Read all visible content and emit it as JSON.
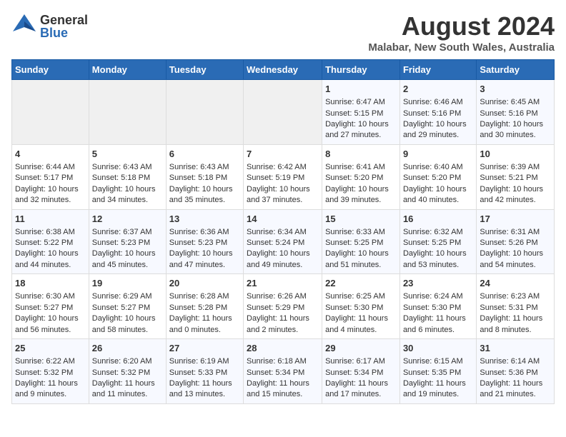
{
  "header": {
    "logo_general": "General",
    "logo_blue": "Blue",
    "month_year": "August 2024",
    "location": "Malabar, New South Wales, Australia"
  },
  "days_of_week": [
    "Sunday",
    "Monday",
    "Tuesday",
    "Wednesday",
    "Thursday",
    "Friday",
    "Saturday"
  ],
  "weeks": [
    [
      {
        "day": "",
        "info": ""
      },
      {
        "day": "",
        "info": ""
      },
      {
        "day": "",
        "info": ""
      },
      {
        "day": "",
        "info": ""
      },
      {
        "day": "1",
        "info": "Sunrise: 6:47 AM\nSunset: 5:15 PM\nDaylight: 10 hours and 27 minutes."
      },
      {
        "day": "2",
        "info": "Sunrise: 6:46 AM\nSunset: 5:16 PM\nDaylight: 10 hours and 29 minutes."
      },
      {
        "day": "3",
        "info": "Sunrise: 6:45 AM\nSunset: 5:16 PM\nDaylight: 10 hours and 30 minutes."
      }
    ],
    [
      {
        "day": "4",
        "info": "Sunrise: 6:44 AM\nSunset: 5:17 PM\nDaylight: 10 hours and 32 minutes."
      },
      {
        "day": "5",
        "info": "Sunrise: 6:43 AM\nSunset: 5:18 PM\nDaylight: 10 hours and 34 minutes."
      },
      {
        "day": "6",
        "info": "Sunrise: 6:43 AM\nSunset: 5:18 PM\nDaylight: 10 hours and 35 minutes."
      },
      {
        "day": "7",
        "info": "Sunrise: 6:42 AM\nSunset: 5:19 PM\nDaylight: 10 hours and 37 minutes."
      },
      {
        "day": "8",
        "info": "Sunrise: 6:41 AM\nSunset: 5:20 PM\nDaylight: 10 hours and 39 minutes."
      },
      {
        "day": "9",
        "info": "Sunrise: 6:40 AM\nSunset: 5:20 PM\nDaylight: 10 hours and 40 minutes."
      },
      {
        "day": "10",
        "info": "Sunrise: 6:39 AM\nSunset: 5:21 PM\nDaylight: 10 hours and 42 minutes."
      }
    ],
    [
      {
        "day": "11",
        "info": "Sunrise: 6:38 AM\nSunset: 5:22 PM\nDaylight: 10 hours and 44 minutes."
      },
      {
        "day": "12",
        "info": "Sunrise: 6:37 AM\nSunset: 5:23 PM\nDaylight: 10 hours and 45 minutes."
      },
      {
        "day": "13",
        "info": "Sunrise: 6:36 AM\nSunset: 5:23 PM\nDaylight: 10 hours and 47 minutes."
      },
      {
        "day": "14",
        "info": "Sunrise: 6:34 AM\nSunset: 5:24 PM\nDaylight: 10 hours and 49 minutes."
      },
      {
        "day": "15",
        "info": "Sunrise: 6:33 AM\nSunset: 5:25 PM\nDaylight: 10 hours and 51 minutes."
      },
      {
        "day": "16",
        "info": "Sunrise: 6:32 AM\nSunset: 5:25 PM\nDaylight: 10 hours and 53 minutes."
      },
      {
        "day": "17",
        "info": "Sunrise: 6:31 AM\nSunset: 5:26 PM\nDaylight: 10 hours and 54 minutes."
      }
    ],
    [
      {
        "day": "18",
        "info": "Sunrise: 6:30 AM\nSunset: 5:27 PM\nDaylight: 10 hours and 56 minutes."
      },
      {
        "day": "19",
        "info": "Sunrise: 6:29 AM\nSunset: 5:27 PM\nDaylight: 10 hours and 58 minutes."
      },
      {
        "day": "20",
        "info": "Sunrise: 6:28 AM\nSunset: 5:28 PM\nDaylight: 11 hours and 0 minutes."
      },
      {
        "day": "21",
        "info": "Sunrise: 6:26 AM\nSunset: 5:29 PM\nDaylight: 11 hours and 2 minutes."
      },
      {
        "day": "22",
        "info": "Sunrise: 6:25 AM\nSunset: 5:30 PM\nDaylight: 11 hours and 4 minutes."
      },
      {
        "day": "23",
        "info": "Sunrise: 6:24 AM\nSunset: 5:30 PM\nDaylight: 11 hours and 6 minutes."
      },
      {
        "day": "24",
        "info": "Sunrise: 6:23 AM\nSunset: 5:31 PM\nDaylight: 11 hours and 8 minutes."
      }
    ],
    [
      {
        "day": "25",
        "info": "Sunrise: 6:22 AM\nSunset: 5:32 PM\nDaylight: 11 hours and 9 minutes."
      },
      {
        "day": "26",
        "info": "Sunrise: 6:20 AM\nSunset: 5:32 PM\nDaylight: 11 hours and 11 minutes."
      },
      {
        "day": "27",
        "info": "Sunrise: 6:19 AM\nSunset: 5:33 PM\nDaylight: 11 hours and 13 minutes."
      },
      {
        "day": "28",
        "info": "Sunrise: 6:18 AM\nSunset: 5:34 PM\nDaylight: 11 hours and 15 minutes."
      },
      {
        "day": "29",
        "info": "Sunrise: 6:17 AM\nSunset: 5:34 PM\nDaylight: 11 hours and 17 minutes."
      },
      {
        "day": "30",
        "info": "Sunrise: 6:15 AM\nSunset: 5:35 PM\nDaylight: 11 hours and 19 minutes."
      },
      {
        "day": "31",
        "info": "Sunrise: 6:14 AM\nSunset: 5:36 PM\nDaylight: 11 hours and 21 minutes."
      }
    ]
  ]
}
